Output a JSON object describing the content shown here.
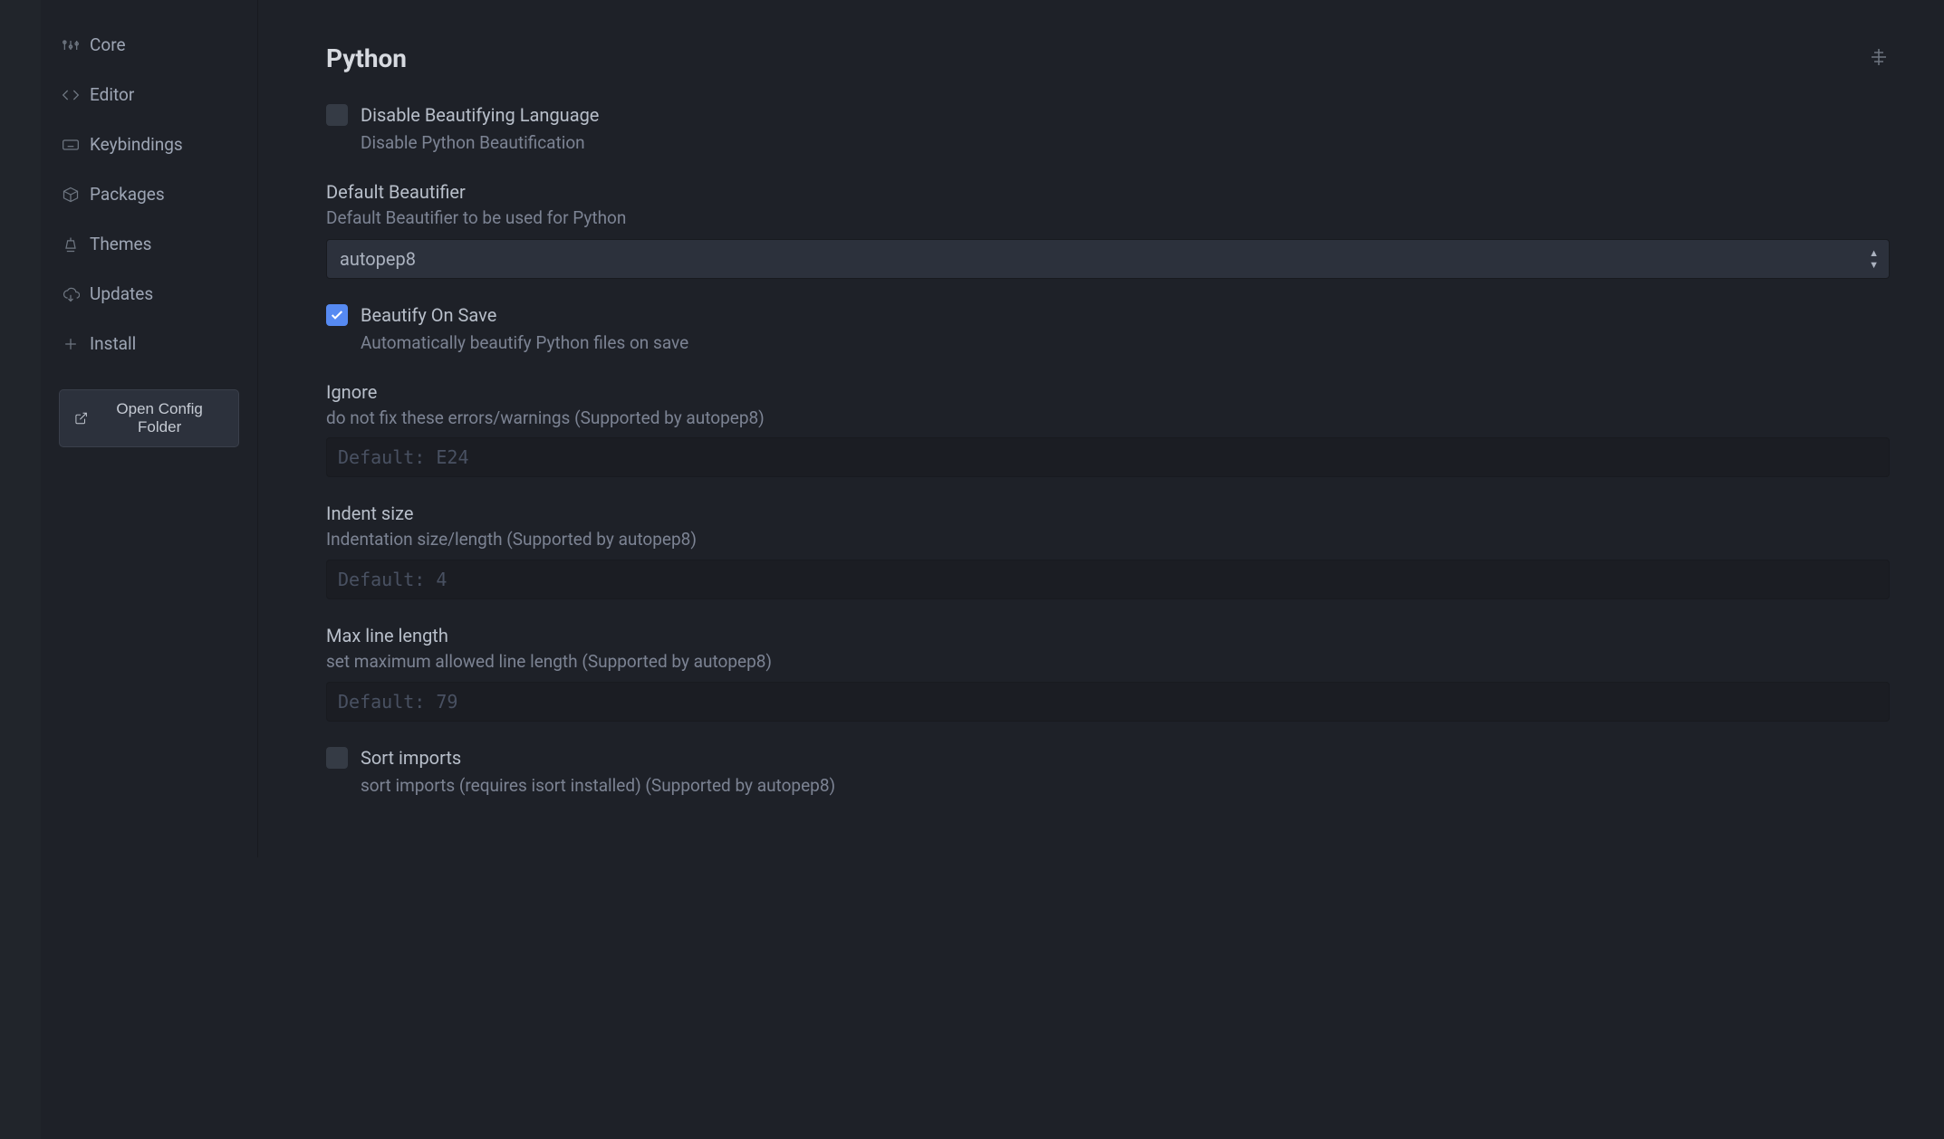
{
  "sidebar": {
    "items": [
      {
        "label": "Core",
        "icon": "sliders"
      },
      {
        "label": "Editor",
        "icon": "code"
      },
      {
        "label": "Keybindings",
        "icon": "keyboard"
      },
      {
        "label": "Packages",
        "icon": "package"
      },
      {
        "label": "Themes",
        "icon": "paintbucket"
      },
      {
        "label": "Updates",
        "icon": "cloud-download"
      },
      {
        "label": "Install",
        "icon": "plus"
      }
    ],
    "config_button": "Open Config Folder"
  },
  "main": {
    "title": "Python",
    "settings": {
      "disable_beautify": {
        "label": "Disable Beautifying Language",
        "desc": "Disable Python Beautification",
        "checked": false
      },
      "default_beautifier": {
        "label": "Default Beautifier",
        "desc": "Default Beautifier to be used for Python",
        "value": "autopep8"
      },
      "beautify_on_save": {
        "label": "Beautify On Save",
        "desc": "Automatically beautify Python files on save",
        "checked": true
      },
      "ignore": {
        "label": "Ignore",
        "desc": "do not fix these errors/warnings (Supported by autopep8)",
        "placeholder": "Default: E24",
        "value": ""
      },
      "indent_size": {
        "label": "Indent size",
        "desc": "Indentation size/length (Supported by autopep8)",
        "placeholder": "Default: 4",
        "value": ""
      },
      "max_line_length": {
        "label": "Max line length",
        "desc": "set maximum allowed line length (Supported by autopep8)",
        "placeholder": "Default: 79",
        "value": ""
      },
      "sort_imports": {
        "label": "Sort imports",
        "desc": "sort imports (requires isort installed) (Supported by autopep8)",
        "checked": false
      }
    }
  }
}
